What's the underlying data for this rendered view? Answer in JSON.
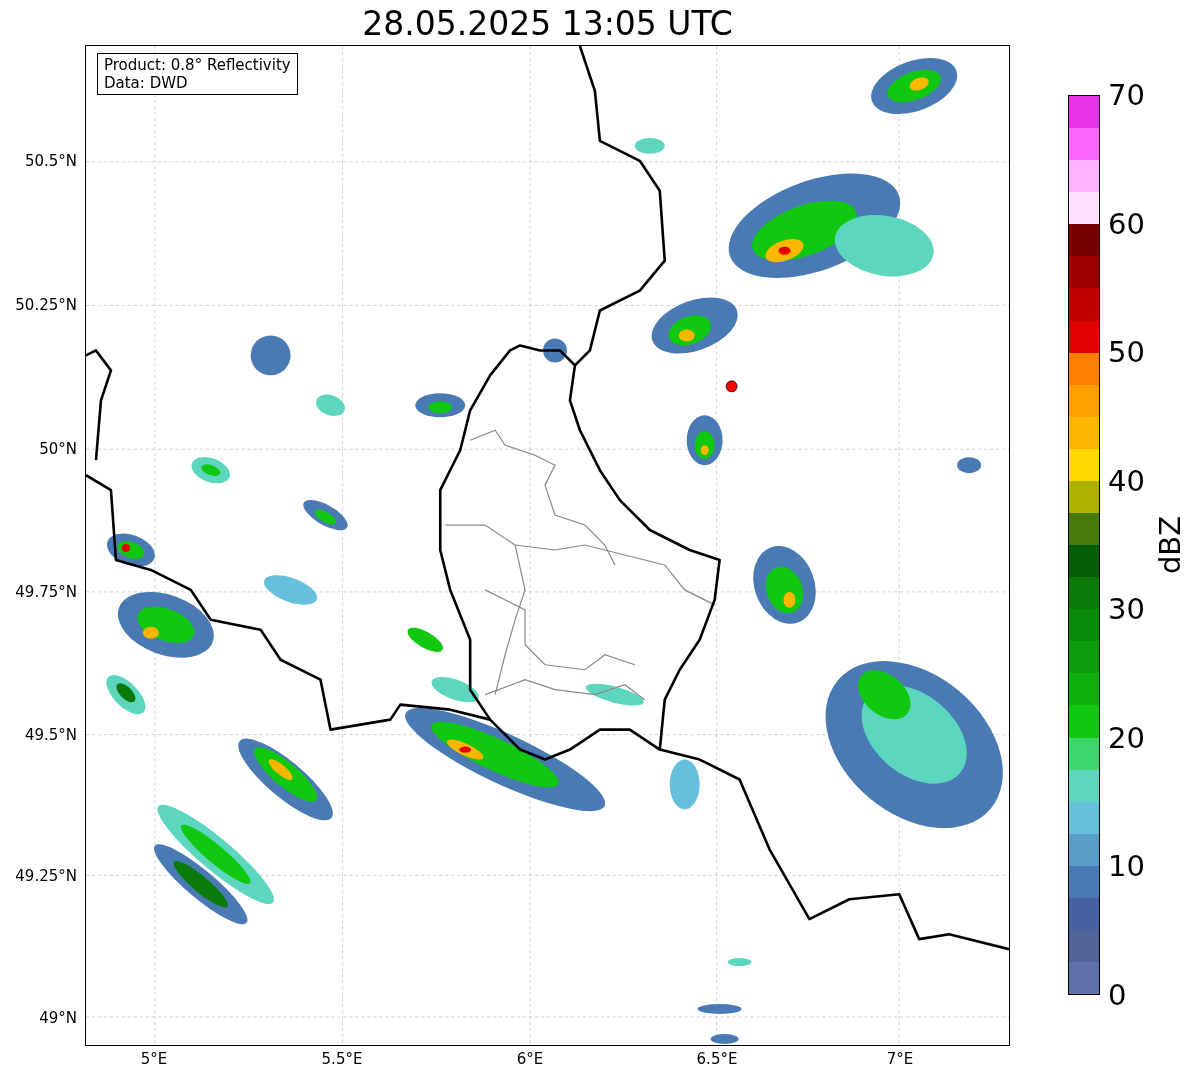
{
  "title": "28.05.2025 13:05 UTC",
  "info_box": [
    "Product: 0.8° Reflectivity",
    "Data: DWD"
  ],
  "x_ticks": [
    "5°E",
    "5.5°E",
    "6°E",
    "6.5°E",
    "7°E"
  ],
  "y_ticks": [
    "50.5°N",
    "50.25°N",
    "50°N",
    "49.75°N",
    "49.5°N",
    "49.25°N",
    "49°N"
  ],
  "colorbar": {
    "label": "dBZ",
    "ticks": [
      "70",
      "60",
      "50",
      "40",
      "30",
      "20",
      "10",
      "0"
    ],
    "segments": [
      {
        "color": "#e933e9"
      },
      {
        "color": "#fd66fd"
      },
      {
        "color": "#feb3fe"
      },
      {
        "color": "#fedffe"
      },
      {
        "color": "#7a0000"
      },
      {
        "color": "#a10000"
      },
      {
        "color": "#c10000"
      },
      {
        "color": "#e20000"
      },
      {
        "color": "#ff7f00"
      },
      {
        "color": "#ff9f00"
      },
      {
        "color": "#ffb600"
      },
      {
        "color": "#ffd800"
      },
      {
        "color": "#b0b000"
      },
      {
        "color": "#467a0a"
      },
      {
        "color": "#075d07"
      },
      {
        "color": "#0a7a0a"
      },
      {
        "color": "#0a8a0a"
      },
      {
        "color": "#0c9c0c"
      },
      {
        "color": "#0eb00e"
      },
      {
        "color": "#10c810"
      },
      {
        "color": "#3cd66c"
      },
      {
        "color": "#5dd6c0"
      },
      {
        "color": "#66c0dc"
      },
      {
        "color": "#5a9ec8"
      },
      {
        "color": "#4a7ab4"
      },
      {
        "color": "#4660a0"
      },
      {
        "color": "#50649a"
      },
      {
        "color": "#6070a8"
      }
    ]
  }
}
